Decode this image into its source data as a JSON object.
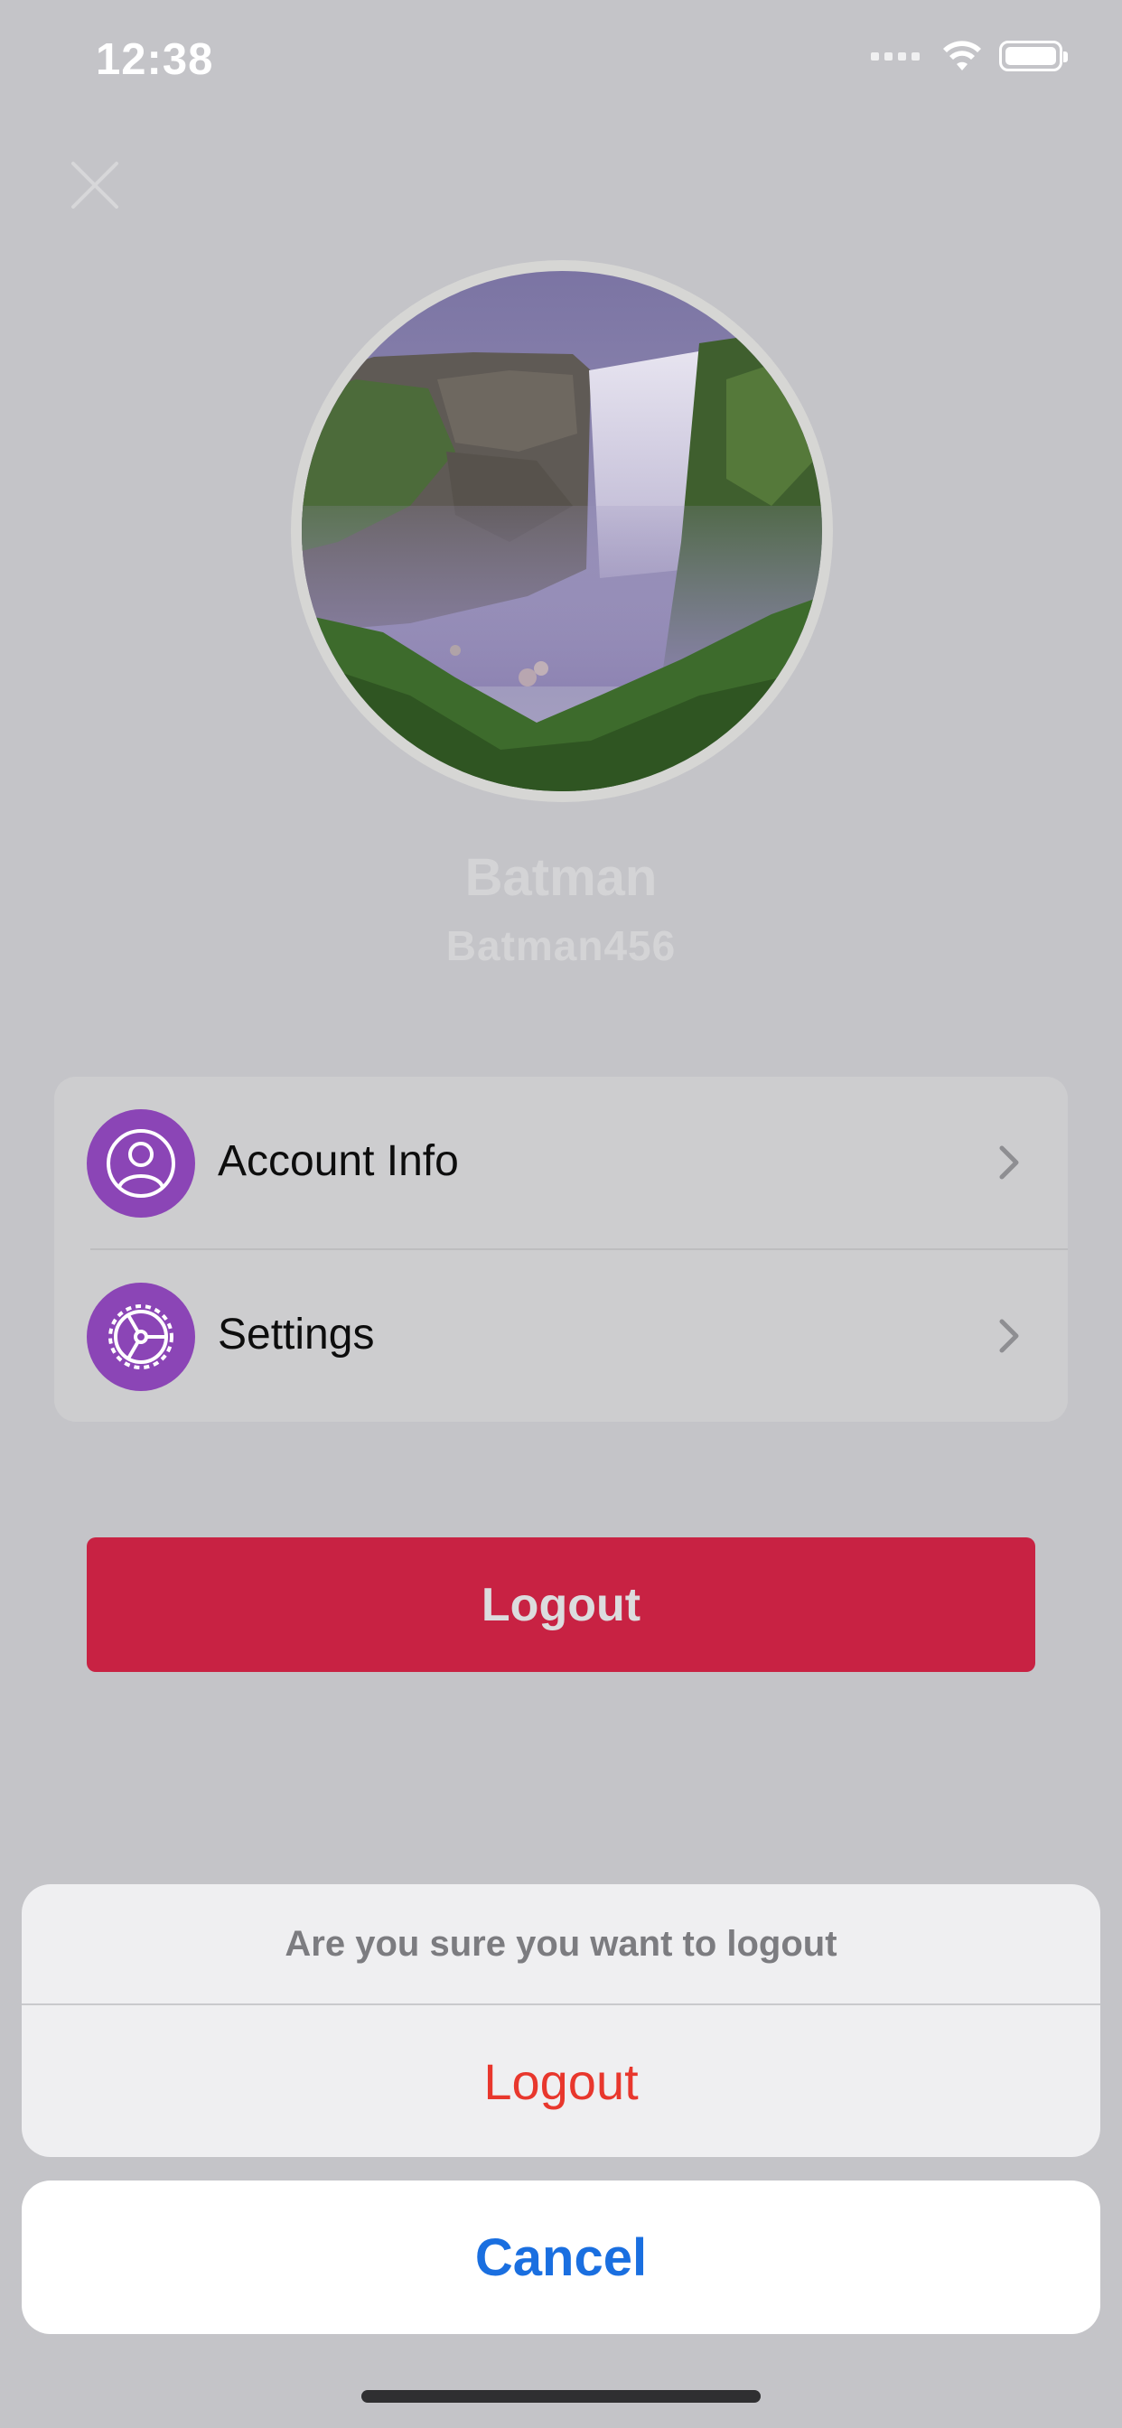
{
  "status_bar": {
    "time": "12:38",
    "icons": [
      "signal-dots-icon",
      "wifi-icon",
      "battery-icon"
    ]
  },
  "header": {
    "close_icon": "close-icon"
  },
  "profile": {
    "avatar_icon": "waterfall-photo",
    "name": "Batman",
    "username": "Batman456"
  },
  "menu": {
    "items": [
      {
        "label": "Account Info",
        "icon": "person-circle-icon"
      },
      {
        "label": "Settings",
        "icon": "gear-icon"
      }
    ]
  },
  "logout_button": {
    "label": "Logout"
  },
  "action_sheet": {
    "title": "Are you sure you want to logout",
    "action": "Logout",
    "cancel": "Cancel"
  },
  "colors": {
    "accent_purple": "#8b45b6",
    "logout_red": "#c82243",
    "destructive_red": "#e8372d",
    "cancel_blue": "#1a6fe0"
  }
}
